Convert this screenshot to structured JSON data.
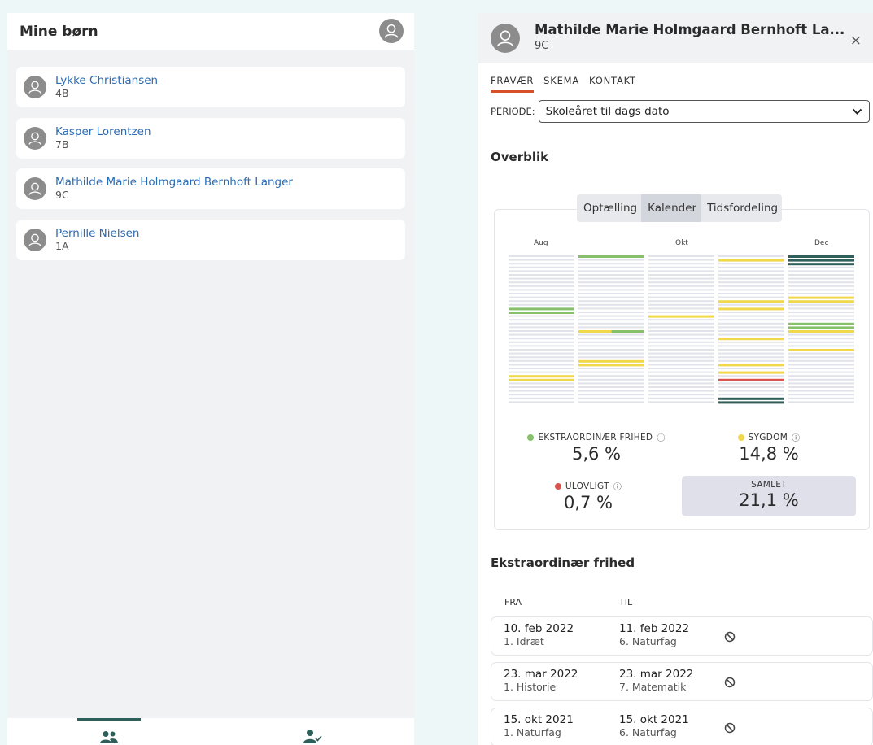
{
  "left": {
    "title": "Mine børn",
    "children": [
      {
        "name": "Lykke Christiansen",
        "class": "4B"
      },
      {
        "name": "Kasper Lorentzen",
        "class": "7B"
      },
      {
        "name": "Mathilde Marie Holmgaard Bernhoft Langer",
        "class": "9C"
      },
      {
        "name": "Pernille Nielsen",
        "class": "1A"
      }
    ],
    "bottom_nav": [
      {
        "icon": "group-icon",
        "active": true
      },
      {
        "icon": "person-check-icon",
        "active": false
      }
    ]
  },
  "right": {
    "name": "Mathilde Marie Holmgaard Bernhoft La...",
    "class": "9C",
    "close": "×",
    "tabs": [
      "FRAVÆR",
      "SKEMA",
      "KONTAKT"
    ],
    "active_tab": "FRAVÆR",
    "periode_label": "PERIODE:",
    "periode_value": "Skoleåret til dags dato",
    "overblik_title": "Overblik",
    "view_toggle": [
      "Optælling",
      "Kalender",
      "Tidsfordeling"
    ],
    "active_view": "Kalender",
    "calendar_months": [
      "Aug",
      "Okt",
      "Dec"
    ],
    "stats": {
      "ekstra_label": "EKSTRAORDINÆR FRIHED",
      "ekstra_value": "5,6 %",
      "sygdom_label": "SYGDOM",
      "sygdom_value": "14,8 %",
      "ulovligt_label": "ULOVLIGT",
      "ulovligt_value": "0,7 %",
      "samlet_label": "SAMLET",
      "samlet_value": "21,1 %",
      "help_glyph": "?"
    },
    "ekstra_title": "Ekstraordinær frihed",
    "table": {
      "headers": [
        "FRA",
        "TIL"
      ],
      "rows": [
        {
          "from_date": "10. feb 2022",
          "from_sub": "1. Idræt",
          "to_date": "11. feb 2022",
          "to_sub": "6. Naturfag"
        },
        {
          "from_date": "23. mar 2022",
          "from_sub": "1. Historie",
          "to_date": "23. mar 2022",
          "to_sub": "7. Matematik"
        },
        {
          "from_date": "15. okt 2021",
          "from_sub": "1. Naturfag",
          "to_date": "15. okt 2021",
          "to_sub": "6. Naturfag"
        }
      ]
    }
  },
  "colors": {
    "accent_tab": "#d85027",
    "link": "#2a6bb3",
    "green": "#86c06a",
    "yellow": "#f0d84a",
    "red": "#d9534f",
    "dark": "#2f5f5a",
    "empty": "#e1e2ea"
  }
}
